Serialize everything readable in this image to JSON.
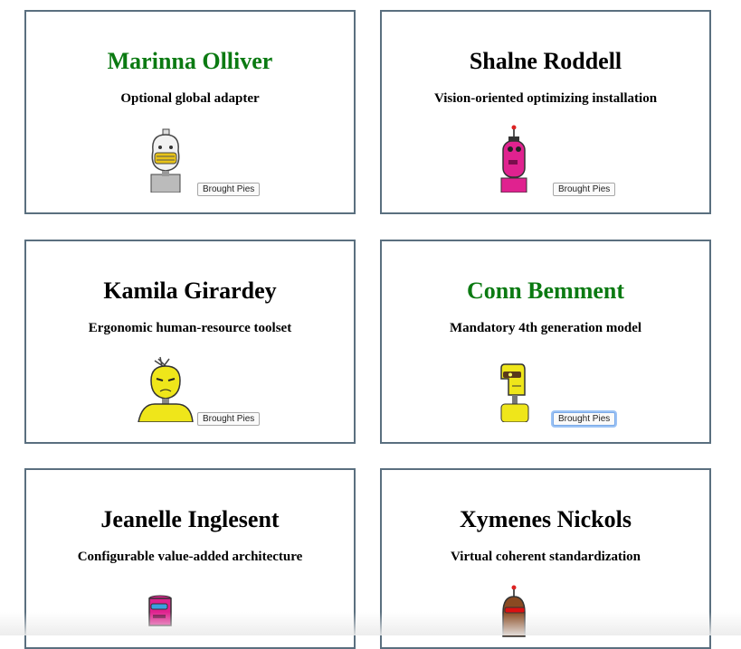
{
  "cards": [
    {
      "name": "Marinna Olliver",
      "tagline": "Optional global adapter",
      "button": "Brought Pies",
      "name_color": "#0b7a12"
    },
    {
      "name": "Shalne Roddell",
      "tagline": "Vision-oriented optimizing installation",
      "button": "Brought Pies"
    },
    {
      "name": "Kamila Girardey",
      "tagline": "Ergonomic human-resource toolset",
      "button": "Brought Pies"
    },
    {
      "name": "Conn Bemment",
      "tagline": "Mandatory 4th generation model",
      "button": "Brought Pies",
      "name_color": "#0b7a12"
    },
    {
      "name": "Jeanelle Inglesent",
      "tagline": "Configurable value-added architecture"
    },
    {
      "name": "Xymenes Nickols",
      "tagline": "Virtual coherent standardization"
    }
  ],
  "icons": [
    "robot-avatar-white",
    "robot-avatar-pink",
    "robot-avatar-yellow",
    "robot-avatar-yellow",
    "robot-avatar-pink",
    "robot-avatar-brown"
  ]
}
